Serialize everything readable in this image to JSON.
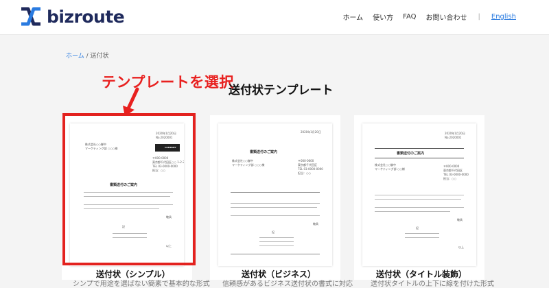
{
  "header": {
    "logo_text": "bizroute",
    "nav": [
      "ホーム",
      "使い方",
      "FAQ",
      "お問い合わせ"
    ],
    "separator": "|",
    "english": "English"
  },
  "breadcrumb": {
    "home": "ホーム",
    "sep": "/",
    "current": "送付状"
  },
  "annotation": "テンプレートを選択",
  "page_title": "送付状テンプレート",
  "cards": [
    {
      "label": "送付状（シンプル）",
      "desc": "シンプで用途を選ばない簡素で基本的な形式",
      "selected": true,
      "doc_title": "書類送付のご案内",
      "company": "COMPANY"
    },
    {
      "label": "送付状（ビジネス）",
      "desc": "信頼感があるビジネス送付状の書式に対応",
      "selected": false,
      "doc_title": "書類送付のご案内"
    },
    {
      "label": "送付状（タイトル装飾）",
      "desc": "送付状タイトルの上下に線を付けた形式",
      "selected": false,
      "doc_title": "書類送付のご案内"
    }
  ],
  "colors": {
    "accent": "#e3221f",
    "link": "#2a7be0",
    "brand": "#1f2a5c"
  }
}
